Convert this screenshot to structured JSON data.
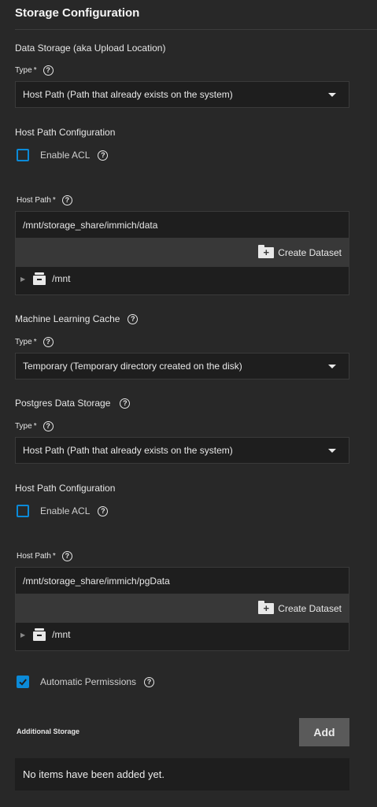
{
  "section_title": "Storage Configuration",
  "data_storage": {
    "label": "Data Storage (aka Upload Location)",
    "type_label": "Type",
    "required": "*",
    "type_value": "Host Path (Path that already exists on the system)",
    "host_path_config_label": "Host Path Configuration",
    "enable_acl_label": "Enable ACL",
    "host_path_label": "Host Path",
    "host_path_value": "/mnt/storage_share/immich/data",
    "create_dataset_label": "Create Dataset",
    "tree_root": "/mnt"
  },
  "ml_cache": {
    "label": "Machine Learning Cache",
    "type_label": "Type",
    "required": "*",
    "type_value": "Temporary (Temporary directory created on the disk)"
  },
  "postgres": {
    "label": "Postgres Data Storage",
    "type_label": "Type",
    "required": "*",
    "type_value": "Host Path (Path that already exists on the system)",
    "host_path_config_label": "Host Path Configuration",
    "enable_acl_label": "Enable ACL",
    "host_path_label": "Host Path",
    "host_path_value": "/mnt/storage_share/immich/pgData",
    "create_dataset_label": "Create Dataset",
    "tree_root": "/mnt",
    "auto_permissions_label": "Automatic Permissions",
    "auto_permissions_checked": true
  },
  "additional_storage": {
    "label": "Additional Storage",
    "add_label": "Add",
    "empty_text": "No items have been added yet."
  },
  "help_glyph": "?",
  "colors": {
    "accent": "#0b8ad8",
    "background": "#282828",
    "field": "#1e1e1e"
  }
}
